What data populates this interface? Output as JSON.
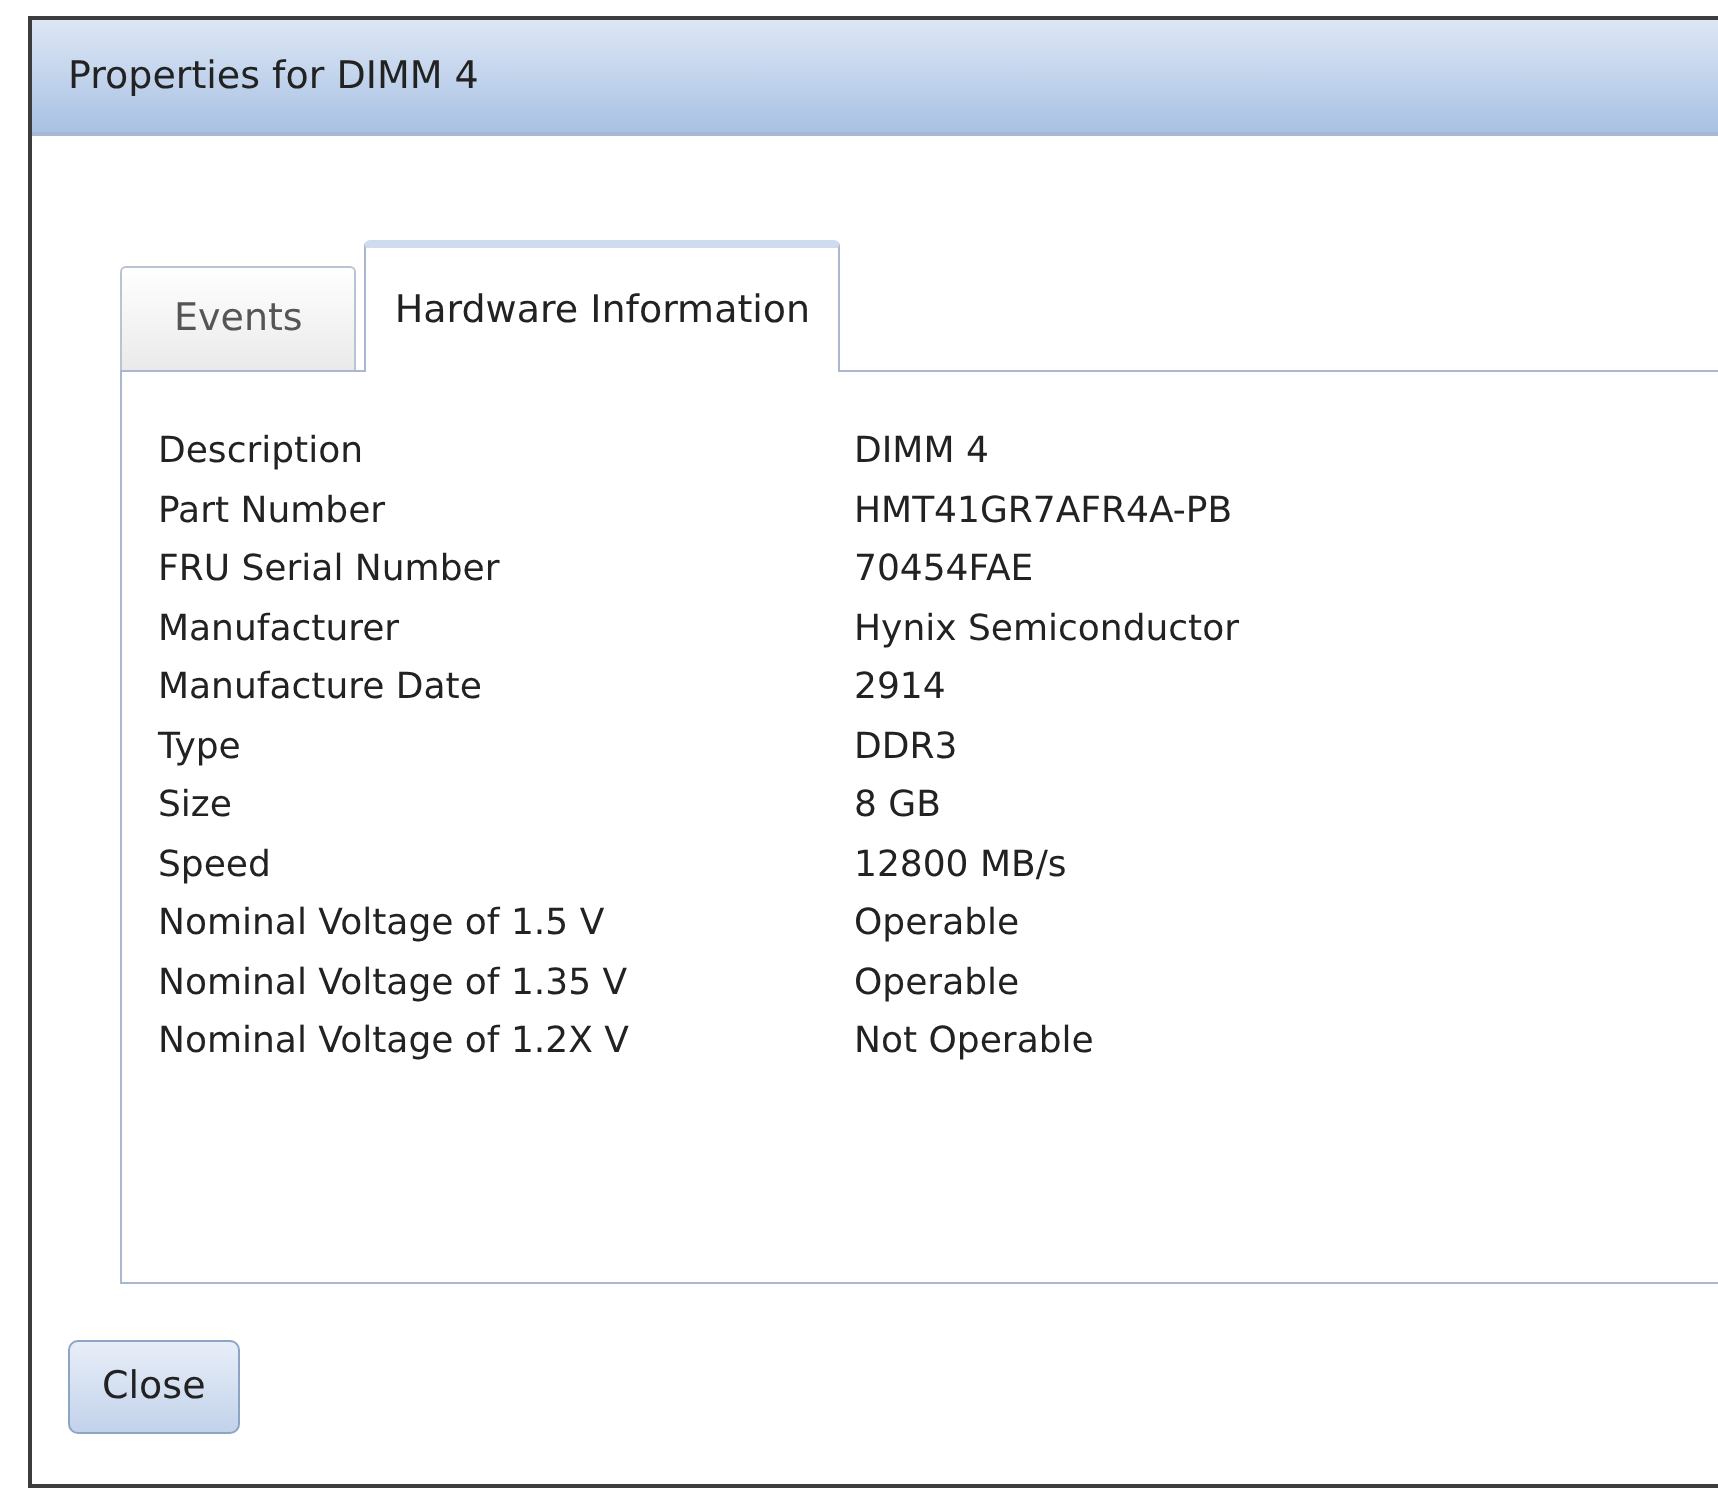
{
  "window": {
    "title": "Properties for DIMM 4"
  },
  "tabs": [
    {
      "label": "Events",
      "selected": false
    },
    {
      "label": "Hardware Information",
      "selected": true
    }
  ],
  "properties": [
    {
      "label": "Description",
      "value": "DIMM 4"
    },
    {
      "label": "Part Number",
      "value": "HMT41GR7AFR4A-PB"
    },
    {
      "label": "FRU Serial Number",
      "value": "70454FAE"
    },
    {
      "label": "Manufacturer",
      "value": "Hynix Semiconductor"
    },
    {
      "label": "Manufacture Date",
      "value": "2914"
    },
    {
      "label": "Type",
      "value": "DDR3"
    },
    {
      "label": "Size",
      "value": "8 GB"
    },
    {
      "label": "Speed",
      "value": "12800 MB/s"
    },
    {
      "label": "Nominal Voltage of 1.5 V",
      "value": "Operable"
    },
    {
      "label": "Nominal Voltage of 1.35 V",
      "value": "Operable"
    },
    {
      "label": "Nominal Voltage of 1.2X V",
      "value": "Not Operable"
    }
  ],
  "buttons": [
    "Close"
  ]
}
